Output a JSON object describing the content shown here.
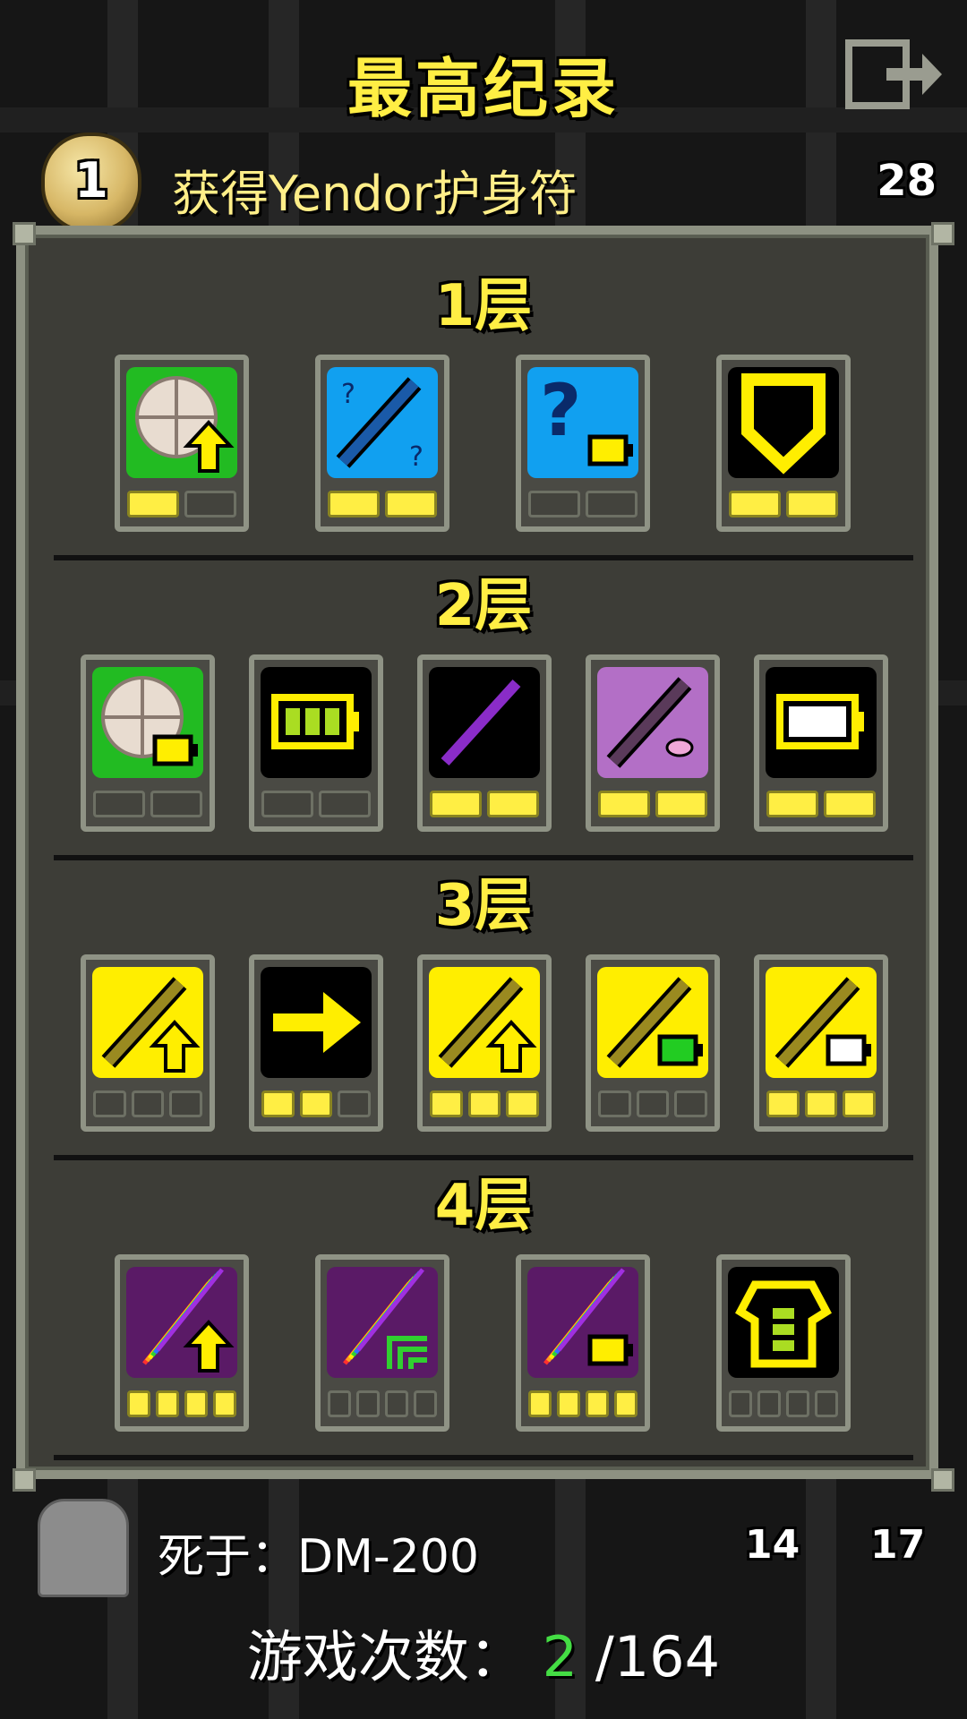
{
  "screen_title": "最高纪录",
  "hero": {
    "badge_number": "1",
    "description": "获得Yendor护身符",
    "level": "28"
  },
  "depths": [
    {
      "label": "1层",
      "items": [
        {
          "icon": "scroll-upgrade-icon",
          "bg": "#22bb22",
          "dots": [
            true,
            false
          ]
        },
        {
          "icon": "wand-unknown-icon",
          "bg": "#11a0f0",
          "dots": [
            true,
            true
          ]
        },
        {
          "icon": "unknown-item-battery-icon",
          "bg": "#11a0f0",
          "dots": [
            false,
            false
          ]
        },
        {
          "icon": "shield-icon",
          "bg": "#000000",
          "dots": [
            true,
            true
          ]
        }
      ]
    },
    {
      "label": "2层",
      "items": [
        {
          "icon": "scroll-battery-icon",
          "bg": "#22bb22",
          "dots": [
            false,
            false
          ]
        },
        {
          "icon": "full-battery-icon",
          "bg": "#000000",
          "dots": [
            false,
            false
          ]
        },
        {
          "icon": "purple-wand-icon",
          "bg": "#000000",
          "dots": [
            true,
            true
          ]
        },
        {
          "icon": "dark-wand-potion-icon",
          "bg": "#b36fc6",
          "dots": [
            true,
            true
          ]
        },
        {
          "icon": "empty-battery-icon",
          "bg": "#000000",
          "dots": [
            true,
            true
          ]
        }
      ]
    },
    {
      "label": "3层",
      "items": [
        {
          "icon": "wand-upgrade-icon",
          "bg": "#ffee00",
          "dots": [
            false,
            false,
            false
          ]
        },
        {
          "icon": "arrow-right-icon",
          "bg": "#000000",
          "dots": [
            true,
            true,
            false
          ]
        },
        {
          "icon": "wand-upgrade-icon",
          "bg": "#ffee00",
          "dots": [
            true,
            true,
            true
          ]
        },
        {
          "icon": "wand-green-battery-icon",
          "bg": "#ffee00",
          "dots": [
            false,
            false,
            false
          ]
        },
        {
          "icon": "wand-white-battery-icon",
          "bg": "#ffee00",
          "dots": [
            true,
            true,
            true
          ]
        }
      ]
    },
    {
      "label": "4层",
      "items": [
        {
          "icon": "rainbow-wand-upgrade-icon",
          "bg": "#5a1a66",
          "dots": [
            true,
            true,
            true,
            true
          ]
        },
        {
          "icon": "rainbow-wand-corner-icon",
          "bg": "#5a1a66",
          "dots": [
            false,
            false,
            false,
            false
          ]
        },
        {
          "icon": "rainbow-wand-battery-icon",
          "bg": "#5a1a66",
          "dots": [
            true,
            true,
            true,
            true
          ]
        },
        {
          "icon": "armor-icon",
          "bg": "#000000",
          "dots": [
            false,
            false,
            false,
            false
          ]
        }
      ]
    }
  ],
  "death": {
    "text": "死于：DM-200",
    "stat_left": "14",
    "stat_right": "17"
  },
  "games": {
    "label": "游戏次数：",
    "current": "2",
    "total": "/164"
  }
}
